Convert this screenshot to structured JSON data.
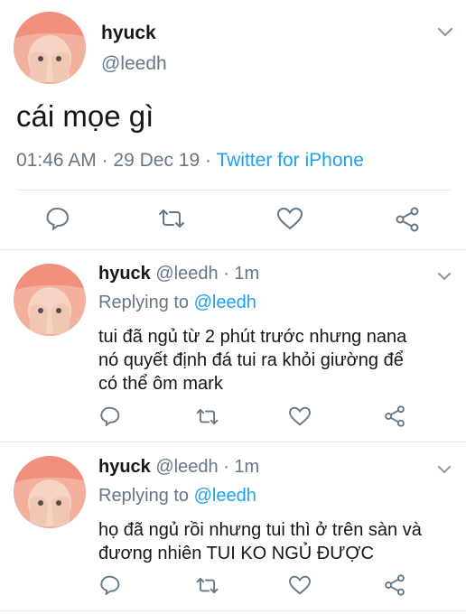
{
  "main_tweet": {
    "display_name": "hyuck",
    "handle": "@leedh",
    "text": "cái mọe gì",
    "time": "01:46 AM",
    "sep1": "·",
    "date": "29 Dec 19",
    "sep2": "·",
    "source": "Twitter for iPhone"
  },
  "replies": [
    {
      "display_name": "hyuck",
      "handle": "@leedh",
      "dot": "·",
      "age": "1m",
      "replying_prefix": "Replying to",
      "replying_handle": "@leedh",
      "text_lines": [
        "tui đã ngủ từ 2 phút trước nhưng nana",
        "nó quyết định đá tui ra khỏi giường để",
        "có thể ôm mark"
      ]
    },
    {
      "display_name": "hyuck",
      "handle": "@leedh",
      "dot": "·",
      "age": "1m",
      "replying_prefix": "Replying to",
      "replying_handle": "@leedh",
      "text_lines": [
        "họ đã ngủ rồi nhưng tui thì ở trên sàn và",
        "đương nhiên TUI KO NGỦ ĐƯỢC"
      ]
    }
  ],
  "icons": {
    "reply": "reply-icon",
    "retweet": "retweet-icon",
    "like": "like-icon",
    "share": "share-icon",
    "more": "chevron-down-icon"
  },
  "colors": {
    "link": "#1da1f2",
    "muted": "#657786",
    "icon": "#657786",
    "divider": "#e1e8ed"
  }
}
